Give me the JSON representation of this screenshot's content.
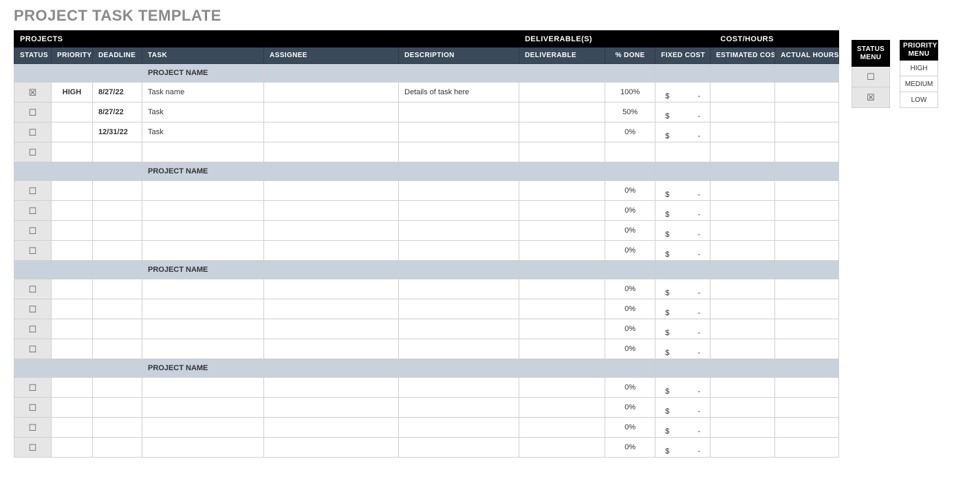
{
  "title": "PROJECT TASK TEMPLATE",
  "topHeaders": {
    "projects": "PROJECTS",
    "deliverables": "DELIVERABLE(S)",
    "costHours": "COST/HOURS"
  },
  "columns": {
    "status": "STATUS",
    "priority": "PRIORITY",
    "deadline": "DEADLINE",
    "task": "TASK",
    "assignee": "ASSIGNEE",
    "description": "DESCRIPTION",
    "deliverable": "DELIVERABLE",
    "pctDone": "% DONE",
    "fixedCost": "FIXED COST",
    "estCost": "ESTIMATED COST",
    "actualHours": "ACTUAL HOURS"
  },
  "costDisplay": {
    "dollar": "$",
    "dash": "-"
  },
  "groups": [
    {
      "name": "PROJECT NAME",
      "rows": [
        {
          "statusChecked": true,
          "priority": "HIGH",
          "deadline": "8/27/22",
          "task": "Task name",
          "assignee": "",
          "description": "Details of task here",
          "deliverable": "",
          "pctDone": "100%",
          "showCost": true
        },
        {
          "statusChecked": false,
          "priority": "",
          "deadline": "8/27/22",
          "task": "Task",
          "assignee": "",
          "description": "",
          "deliverable": "",
          "pctDone": "50%",
          "showCost": true
        },
        {
          "statusChecked": false,
          "priority": "",
          "deadline": "12/31/22",
          "task": "Task",
          "assignee": "",
          "description": "",
          "deliverable": "",
          "pctDone": "0%",
          "showCost": true
        },
        {
          "statusChecked": false,
          "priority": "",
          "deadline": "",
          "task": "",
          "assignee": "",
          "description": "",
          "deliverable": "",
          "pctDone": "",
          "showCost": false
        }
      ]
    },
    {
      "name": "PROJECT NAME",
      "rows": [
        {
          "statusChecked": false,
          "priority": "",
          "deadline": "",
          "task": "",
          "assignee": "",
          "description": "",
          "deliverable": "",
          "pctDone": "0%",
          "showCost": true
        },
        {
          "statusChecked": false,
          "priority": "",
          "deadline": "",
          "task": "",
          "assignee": "",
          "description": "",
          "deliverable": "",
          "pctDone": "0%",
          "showCost": true
        },
        {
          "statusChecked": false,
          "priority": "",
          "deadline": "",
          "task": "",
          "assignee": "",
          "description": "",
          "deliverable": "",
          "pctDone": "0%",
          "showCost": true
        },
        {
          "statusChecked": false,
          "priority": "",
          "deadline": "",
          "task": "",
          "assignee": "",
          "description": "",
          "deliverable": "",
          "pctDone": "0%",
          "showCost": true
        }
      ]
    },
    {
      "name": "PROJECT NAME",
      "rows": [
        {
          "statusChecked": false,
          "priority": "",
          "deadline": "",
          "task": "",
          "assignee": "",
          "description": "",
          "deliverable": "",
          "pctDone": "0%",
          "showCost": true
        },
        {
          "statusChecked": false,
          "priority": "",
          "deadline": "",
          "task": "",
          "assignee": "",
          "description": "",
          "deliverable": "",
          "pctDone": "0%",
          "showCost": true
        },
        {
          "statusChecked": false,
          "priority": "",
          "deadline": "",
          "task": "",
          "assignee": "",
          "description": "",
          "deliverable": "",
          "pctDone": "0%",
          "showCost": true
        },
        {
          "statusChecked": false,
          "priority": "",
          "deadline": "",
          "task": "",
          "assignee": "",
          "description": "",
          "deliverable": "",
          "pctDone": "0%",
          "showCost": true
        }
      ]
    },
    {
      "name": "PROJECT NAME",
      "rows": [
        {
          "statusChecked": false,
          "priority": "",
          "deadline": "",
          "task": "",
          "assignee": "",
          "description": "",
          "deliverable": "",
          "pctDone": "0%",
          "showCost": true
        },
        {
          "statusChecked": false,
          "priority": "",
          "deadline": "",
          "task": "",
          "assignee": "",
          "description": "",
          "deliverable": "",
          "pctDone": "0%",
          "showCost": true
        },
        {
          "statusChecked": false,
          "priority": "",
          "deadline": "",
          "task": "",
          "assignee": "",
          "description": "",
          "deliverable": "",
          "pctDone": "0%",
          "showCost": true
        },
        {
          "statusChecked": false,
          "priority": "",
          "deadline": "",
          "task": "",
          "assignee": "",
          "description": "",
          "deliverable": "",
          "pctDone": "0%",
          "showCost": true
        }
      ]
    }
  ],
  "statusMenu": {
    "title": "STATUS MENU",
    "items": [
      {
        "checked": false
      },
      {
        "checked": true
      }
    ]
  },
  "priorityMenu": {
    "title": "PRIORITY MENU",
    "items": [
      "HIGH",
      "MEDIUM",
      "LOW"
    ]
  },
  "glyph": {
    "checked": "☒",
    "unchecked": "☐"
  }
}
